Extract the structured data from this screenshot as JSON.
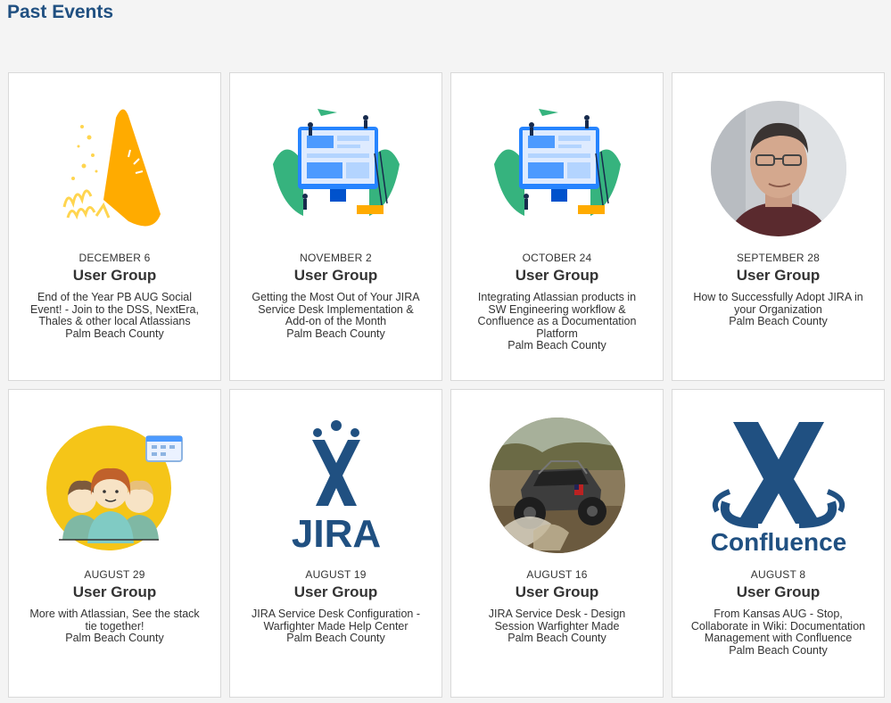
{
  "page": {
    "title": "Past Events"
  },
  "events": [
    {
      "date": "DECEMBER 6",
      "type": "User Group",
      "title": "End of the Year PB AUG Social Event! - Join to the DSS, NextEra, Thales & other local Atlassians",
      "location": "Palm Beach County",
      "image": "celebration-illustration"
    },
    {
      "date": "NOVEMBER 2",
      "type": "User Group",
      "title": "Getting the Most Out of Your JIRA Service Desk Implementation & Add-on of the Month",
      "location": "Palm Beach County",
      "image": "team-building-illustration"
    },
    {
      "date": "OCTOBER 24",
      "type": "User Group",
      "title": "Integrating Atlassian products in SW Engineering workflow & Confluence as a Documentation Platform",
      "location": "Palm Beach County",
      "image": "team-building-illustration"
    },
    {
      "date": "SEPTEMBER 28",
      "type": "User Group",
      "title": "How to Successfully Adopt JIRA in your Organization",
      "location": "Palm Beach County",
      "image": "speaker-photo"
    },
    {
      "date": "AUGUST 29",
      "type": "User Group",
      "title": "More with Atlassian, See the stack tie together!",
      "location": "Palm Beach County",
      "image": "support-team-illustration"
    },
    {
      "date": "AUGUST 19",
      "type": "User Group",
      "title": "JIRA Service Desk Configuration - Warfighter Made Help Center",
      "location": "Palm Beach County",
      "image": "jira-logo",
      "logo_text": "JIRA"
    },
    {
      "date": "AUGUST 16",
      "type": "User Group",
      "title": "JIRA Service Desk - Design Session Warfighter Made",
      "location": "Palm Beach County",
      "image": "offroad-vehicle-photo"
    },
    {
      "date": "AUGUST 8",
      "type": "User Group",
      "title": "From Kansas AUG - Stop, Collaborate in Wiki: Documentation Management with Confluence",
      "location": "Palm Beach County",
      "image": "confluence-logo",
      "logo_text": "Confluence"
    }
  ]
}
